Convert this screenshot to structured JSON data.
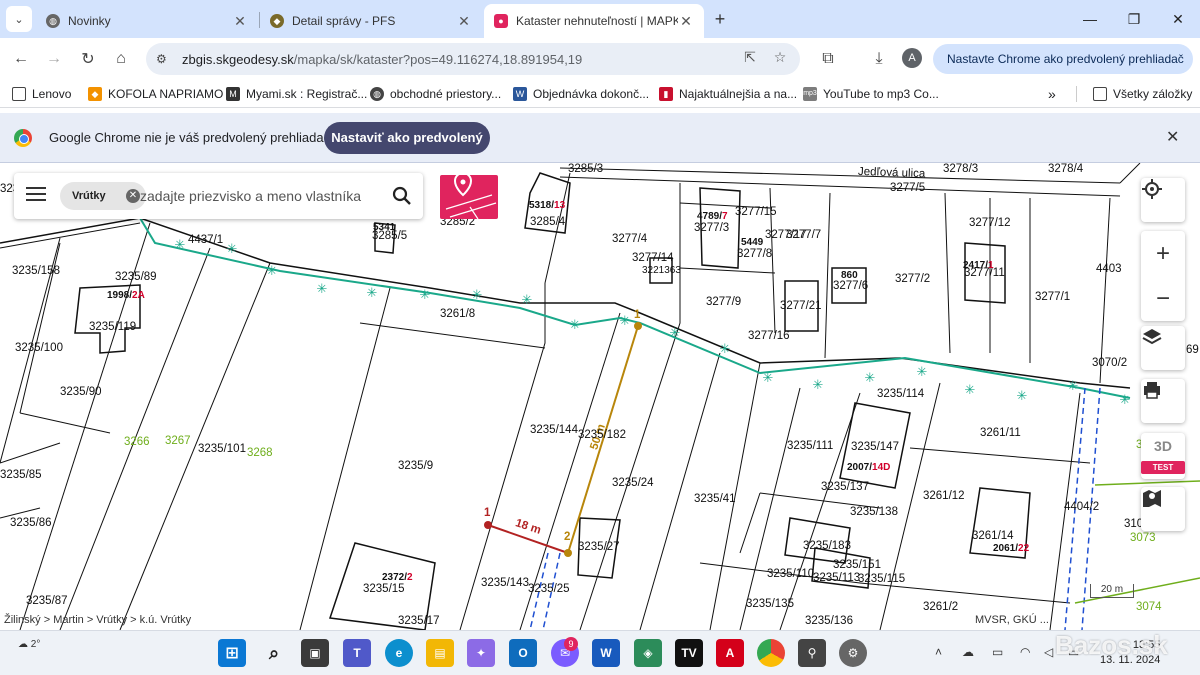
{
  "browser": {
    "tabs": [
      {
        "title": "Novinky",
        "active": false
      },
      {
        "title": "Detail správy - PFS",
        "active": false
      },
      {
        "title": "Kataster nehnuteľností | MAPKA",
        "active": true
      }
    ],
    "url_host": "zbgis.skgeodesy.sk",
    "url_path": "/mapka/sk/kataster?pos=49.116274,18.891954,19",
    "profile_initial": "A",
    "default_browser_pill": "Nastavte Chrome ako predvolený prehliadač",
    "new_tab_glyph": "+",
    "window_controls": {
      "minimize": "—",
      "maximize": "❐",
      "close": "✕"
    }
  },
  "bookmarks": {
    "items": [
      "Lenovo",
      "KOFOLA NAPRIAMO",
      "Myami.sk : Registrač...",
      "obchodné priestory...",
      "Objednávka dokonč...",
      "Najaktuálnejšia a na...",
      "YouTube to mp3 Co..."
    ],
    "overflow": "»",
    "all_bookmarks": "Všetky záložky"
  },
  "infobar": {
    "message": "Google Chrome nie je váš predvolený prehliadač",
    "button": "Nastaviť ako predvolený"
  },
  "search": {
    "chip": "Vrútky",
    "placeholder": "zadajte priezvisko a meno vlastníka"
  },
  "map": {
    "street": "Jedľová ulica",
    "parcels": {
      "p1": "3235/158",
      "p2": "4437/1",
      "p3": "3235/89",
      "p4": "3235/119",
      "p5": "3235/100",
      "p6": "3235/90",
      "p7": "3235/85",
      "p8": "3235/86",
      "p9": "3235/87",
      "p10": "3235/101",
      "p11": "3235/9",
      "p12": "3261/8",
      "p13": "3285/5",
      "p14": "3285/2",
      "p15": "3285/4",
      "p16": "3285/3",
      "p17": "3277/4",
      "p18": "3277/3",
      "p19": "3277/15",
      "p20": "3277/17",
      "p21": "3277/7",
      "p22": "3277/8",
      "p23": "3277/14",
      "p24": "3221363",
      "p25": "3277/9",
      "p26": "3277/21",
      "p27": "3277/16",
      "p28": "3277/6",
      "p29": "3277/2",
      "p30": "3277/12",
      "p31": "3277/11",
      "p32": "3277/1",
      "p33": "3278/3",
      "p34": "3278/4",
      "p35": "3277/5",
      "p36": "4403",
      "p37": "3235/144",
      "p38": "3235/182",
      "p39": "3235/24",
      "p40": "3235/41",
      "p41": "3235/111",
      "p42": "3235/114",
      "p43": "3235/147",
      "p44": "3235/137",
      "p45": "3235/138",
      "p46": "3261/11",
      "p47": "3261/12",
      "p48": "3261/14",
      "p49": "4404/2",
      "p50": "3235/27",
      "p51": "3235/143",
      "p52": "3235/25",
      "p53": "3235/15",
      "p54": "3235/17",
      "p55": "3235/183",
      "p56": "3235/110",
      "p57": "3235/151",
      "p58": "3235/113",
      "p59": "3235/115",
      "p60": "3235/135",
      "p61": "3235/136",
      "p62": "3261/2",
      "p63": "3070/2",
      "p64": "310",
      "p65": "69",
      "p66": "3235/"
    },
    "green_parcels": {
      "g1": "3266",
      "g2": "3267",
      "g3": "3268",
      "g4": "3073",
      "g5": "3074",
      "g6": "3"
    },
    "buildings": {
      "b1": {
        "num": "1998/",
        "suffix": "2A"
      },
      "b2": {
        "num": "5318/",
        "suffix": "13"
      },
      "b3": {
        "num": "4789/",
        "suffix": "7"
      },
      "b4": {
        "num": "2417/",
        "suffix": "1"
      },
      "b5": {
        "num": "2007/",
        "suffix": "14D"
      },
      "b6": {
        "num": "2061/",
        "suffix": "22"
      },
      "b7": {
        "num": "2372/",
        "suffix": "2"
      },
      "b8": "5341",
      "b9": "5449",
      "b10": "860"
    },
    "measure": {
      "segment1": "18 m",
      "segment2": "50 m",
      "point1": "1",
      "point2": "2",
      "point3": "1"
    },
    "scale": "20 m",
    "breadcrumb": "Žilinský > Martin > Vrútky > k.ú. Vrútky",
    "attribution": "MVSR, GKÚ ...",
    "zoom_in": "+",
    "zoom_out": "−",
    "btn_3d": "3D",
    "btn_3d_badge": "TEST"
  },
  "taskbar": {
    "temperature": "2°",
    "messenger_badge": "9",
    "time": "13:55",
    "date": "13. 11. 2024"
  },
  "watermark": "Bazos.sk",
  "colors": {
    "accent": "#e0245e",
    "boundary_green": "#1aa88a",
    "measure": "#b8860b",
    "infobar_button": "#44476e"
  }
}
